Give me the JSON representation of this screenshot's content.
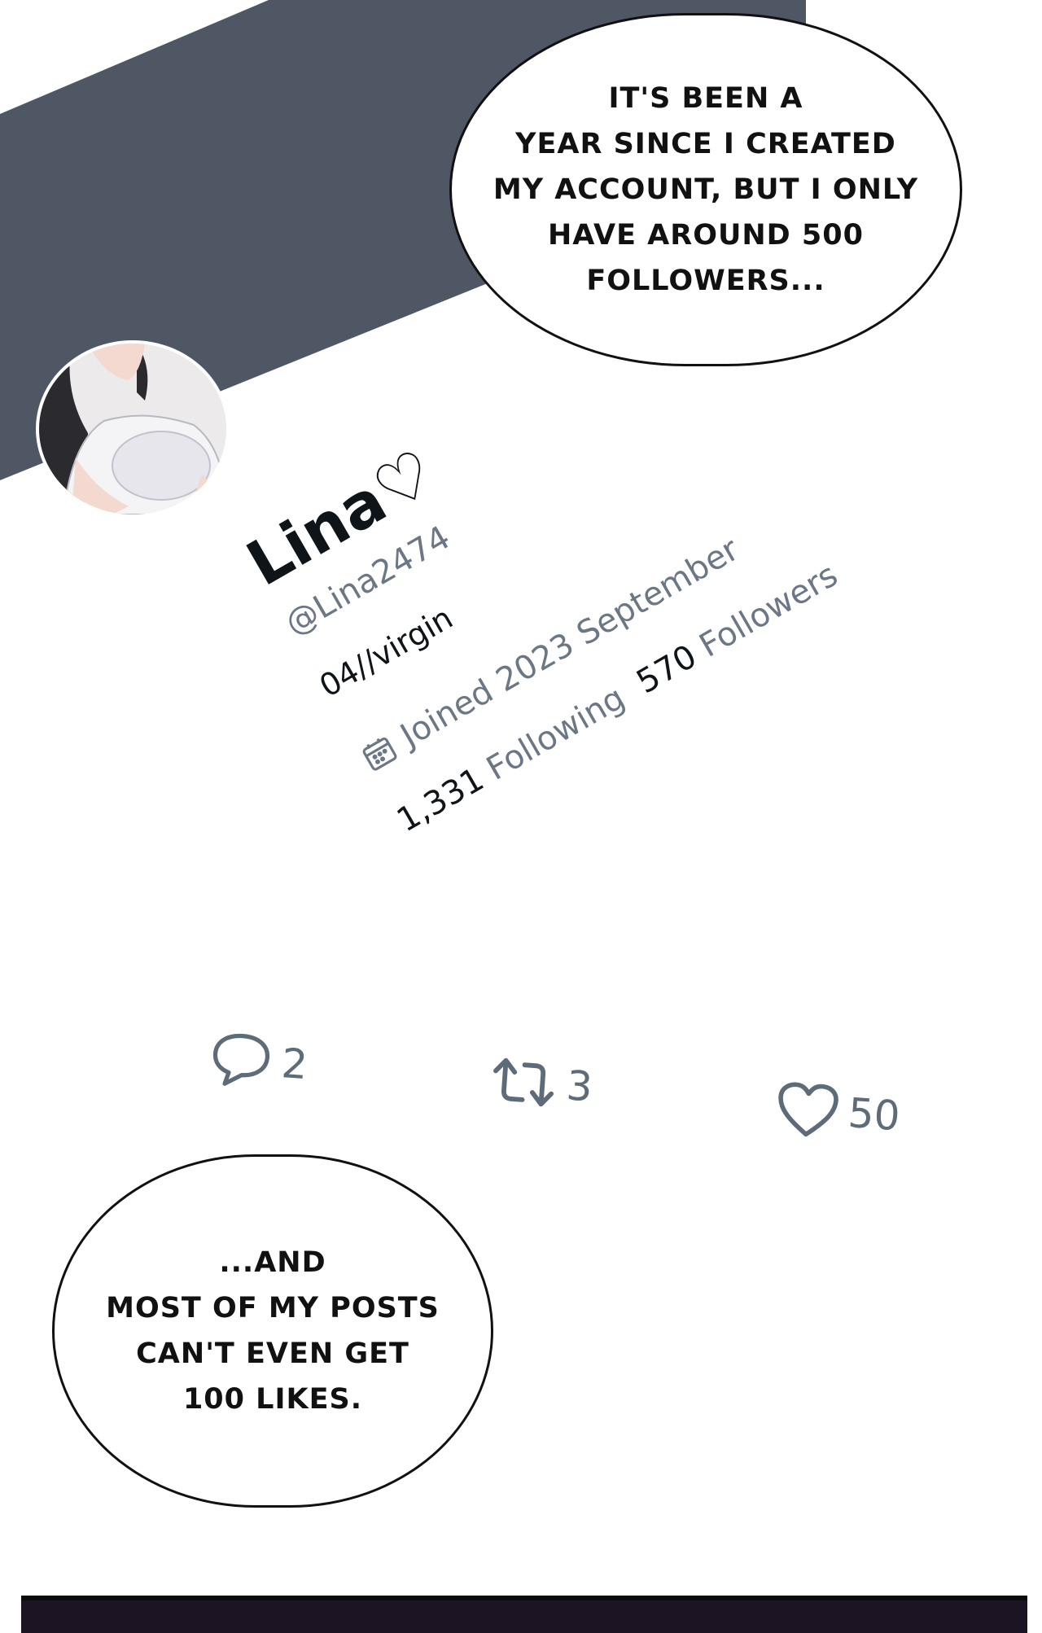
{
  "colors": {
    "banner": "#4f5764",
    "text_primary": "#0f1419",
    "text_secondary": "#6b7785",
    "action_icon": "#5e6b78",
    "bottom_bar": "#1c1422"
  },
  "bubbles": {
    "top": "IT'S BEEN A\nYEAR SINCE I CREATED\nMY ACCOUNT, BUT I ONLY\nHAVE AROUND 500\nFOLLOWERS...",
    "bottom": "...AND\nMOST OF MY POSTS\nCAN'T EVEN GET\n100 LIKES."
  },
  "profile": {
    "name": "Lina",
    "name_symbol": "♡",
    "handle": "@Lina2474",
    "bio": "04//virgin",
    "joined": "Joined 2023 September",
    "joined_icon": "calendar-icon",
    "following_count": "1,331",
    "following_label": "Following",
    "followers_count": "570",
    "followers_label": "Followers"
  },
  "actions": {
    "replies": "2",
    "reposts": "3",
    "likes": "50"
  }
}
